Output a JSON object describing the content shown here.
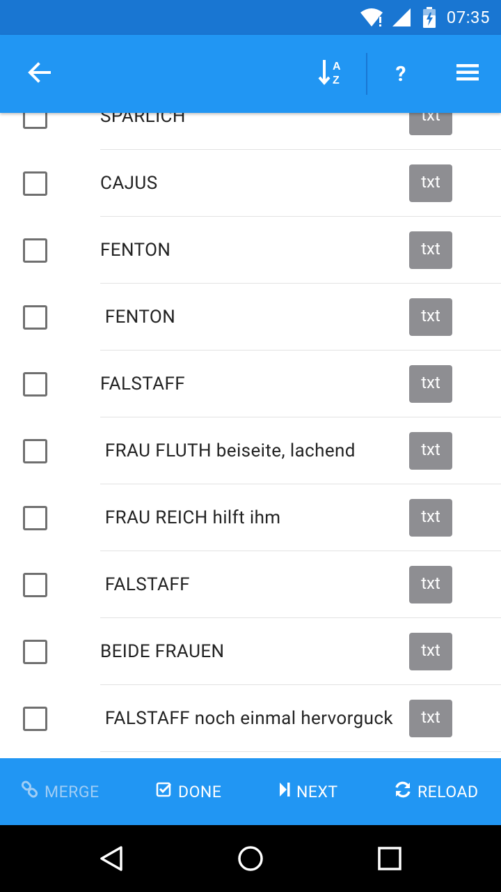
{
  "status_bar": {
    "time": "07:35",
    "icons": [
      "wifi-alert-icon",
      "cell-signal-icon",
      "battery-charging-icon"
    ],
    "color": "#1976D2"
  },
  "app_bar": {
    "color": "#2196F3",
    "back_icon": "arrow-back-icon",
    "sort_icon": "sort-az-icon",
    "help_label": "?",
    "menu_icon": "hamburger-menu-icon",
    "sort_letter_top": "A",
    "sort_letter_bottom": "Z"
  },
  "list": {
    "button_label": "txt",
    "rows": [
      {
        "label": "SPÄRLICH",
        "checked": false
      },
      {
        "label": "CAJUS",
        "checked": false
      },
      {
        "label": "FENTON",
        "checked": false
      },
      {
        "label": " FENTON",
        "checked": false
      },
      {
        "label": "FALSTAFF",
        "checked": false
      },
      {
        "label": " FRAU FLUTH beiseite, lachend",
        "checked": false
      },
      {
        "label": " FRAU REICH hilft ihm",
        "checked": false
      },
      {
        "label": " FALSTAFF",
        "checked": false
      },
      {
        "label": "BEIDE FRAUEN",
        "checked": false
      },
      {
        "label": " FALSTAFF noch einmal hervorguck",
        "checked": false
      }
    ]
  },
  "actions": {
    "merge": {
      "label": "MERGE",
      "icon": "link-icon",
      "enabled": false
    },
    "done": {
      "label": "DONE",
      "icon": "check-box-icon",
      "enabled": true
    },
    "next": {
      "label": "NEXT",
      "icon": "skip-next-icon",
      "enabled": true
    },
    "reload": {
      "label": "RELOAD",
      "icon": "refresh-icon",
      "enabled": true
    }
  },
  "nav_bar": {
    "icons": [
      "nav-back-icon",
      "nav-home-icon",
      "nav-recents-icon"
    ]
  }
}
